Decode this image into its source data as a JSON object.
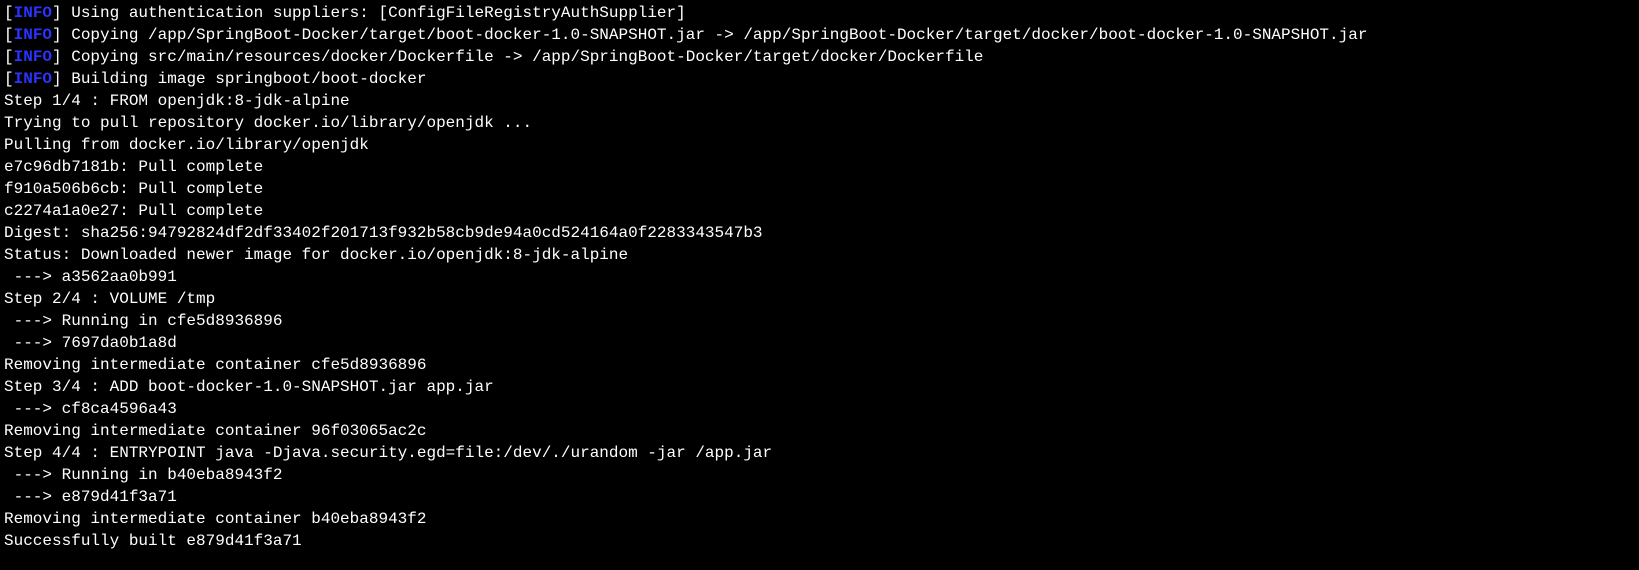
{
  "colors": {
    "background": "#000000",
    "foreground": "#ffffff",
    "info": "#2b33ff"
  },
  "info_label": "INFO",
  "lines": [
    {
      "type": "info",
      "text": "Using authentication suppliers: [ConfigFileRegistryAuthSupplier]"
    },
    {
      "type": "info",
      "text": "Copying /app/SpringBoot-Docker/target/boot-docker-1.0-SNAPSHOT.jar -> /app/SpringBoot-Docker/target/docker/boot-docker-1.0-SNAPSHOT.jar"
    },
    {
      "type": "info",
      "text": "Copying src/main/resources/docker/Dockerfile -> /app/SpringBoot-Docker/target/docker/Dockerfile"
    },
    {
      "type": "info",
      "text": "Building image springboot/boot-docker"
    },
    {
      "type": "plain",
      "text": "Step 1/4 : FROM openjdk:8-jdk-alpine"
    },
    {
      "type": "plain",
      "text": "Trying to pull repository docker.io/library/openjdk ..."
    },
    {
      "type": "plain",
      "text": "Pulling from docker.io/library/openjdk"
    },
    {
      "type": "plain",
      "text": "e7c96db7181b: Pull complete"
    },
    {
      "type": "plain",
      "text": "f910a506b6cb: Pull complete"
    },
    {
      "type": "plain",
      "text": "c2274a1a0e27: Pull complete"
    },
    {
      "type": "plain",
      "text": "Digest: sha256:94792824df2df33402f201713f932b58cb9de94a0cd524164a0f2283343547b3"
    },
    {
      "type": "plain",
      "text": "Status: Downloaded newer image for docker.io/openjdk:8-jdk-alpine"
    },
    {
      "type": "plain",
      "text": " ---> a3562aa0b991"
    },
    {
      "type": "plain",
      "text": "Step 2/4 : VOLUME /tmp"
    },
    {
      "type": "plain",
      "text": " ---> Running in cfe5d8936896"
    },
    {
      "type": "plain",
      "text": " ---> 7697da0b1a8d"
    },
    {
      "type": "plain",
      "text": "Removing intermediate container cfe5d8936896"
    },
    {
      "type": "plain",
      "text": "Step 3/4 : ADD boot-docker-1.0-SNAPSHOT.jar app.jar"
    },
    {
      "type": "plain",
      "text": " ---> cf8ca4596a43"
    },
    {
      "type": "plain",
      "text": "Removing intermediate container 96f03065ac2c"
    },
    {
      "type": "plain",
      "text": "Step 4/4 : ENTRYPOINT java -Djava.security.egd=file:/dev/./urandom -jar /app.jar"
    },
    {
      "type": "plain",
      "text": " ---> Running in b40eba8943f2"
    },
    {
      "type": "plain",
      "text": " ---> e879d41f3a71"
    },
    {
      "type": "plain",
      "text": "Removing intermediate container b40eba8943f2"
    },
    {
      "type": "plain",
      "text": "Successfully built e879d41f3a71"
    }
  ]
}
